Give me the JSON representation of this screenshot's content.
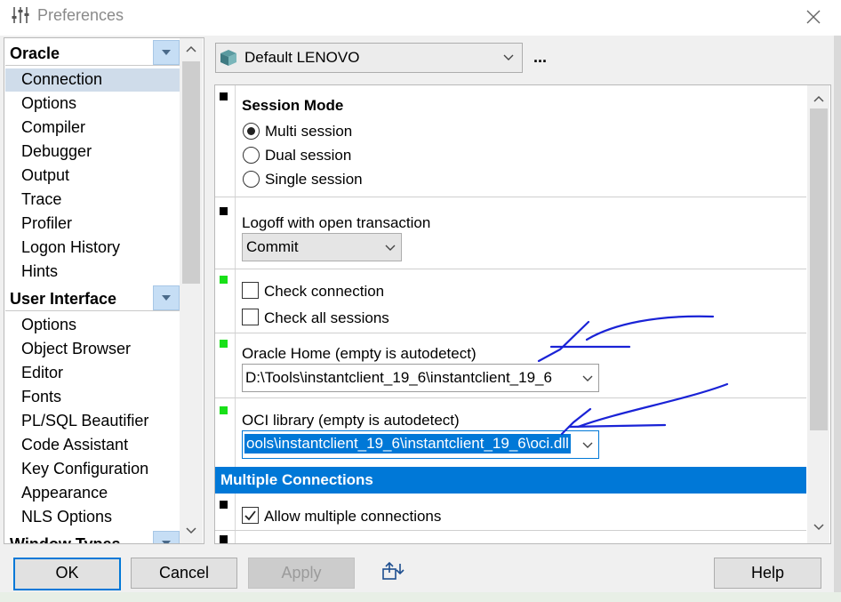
{
  "window": {
    "title": "Preferences"
  },
  "sidebar": {
    "oracle_header": "Oracle",
    "oracle_items": [
      "Connection",
      "Options",
      "Compiler",
      "Debugger",
      "Output",
      "Trace",
      "Profiler",
      "Logon History",
      "Hints"
    ],
    "ui_header": "User Interface",
    "ui_items": [
      "Options",
      "Object Browser",
      "Editor",
      "Fonts",
      "PL/SQL Beautifier",
      "Code Assistant",
      "Key Configuration",
      "Appearance",
      "NLS Options"
    ],
    "window_types_header": "Window Types",
    "selected": "Connection"
  },
  "profile": {
    "value": "Default LENOVO",
    "more_label": "..."
  },
  "settings": {
    "session_mode": {
      "title": "Session Mode",
      "options": [
        "Multi session",
        "Dual session",
        "Single session"
      ],
      "selected": "Multi session"
    },
    "logoff": {
      "label": "Logoff with open transaction",
      "value": "Commit"
    },
    "check_connection": {
      "label": "Check connection",
      "checked": false
    },
    "check_all_sessions": {
      "label": "Check all sessions",
      "checked": false
    },
    "oracle_home": {
      "label": "Oracle Home (empty is autodetect)",
      "value": "D:\\Tools\\instantclient_19_6\\instantclient_19_6"
    },
    "oci_library": {
      "label": "OCI library (empty is autodetect)",
      "value": "ools\\instantclient_19_6\\instantclient_19_6\\oci.dll"
    },
    "multiple_connections": {
      "section_title": "Multiple Connections",
      "allow_label": "Allow multiple connections",
      "checked": true
    }
  },
  "buttons": {
    "ok": "OK",
    "cancel": "Cancel",
    "apply": "Apply",
    "help": "Help"
  },
  "colors": {
    "accent": "#0078d7",
    "selection": "#cfdcea",
    "marker_green": "#18e018",
    "annotation": "#1a23d6"
  }
}
